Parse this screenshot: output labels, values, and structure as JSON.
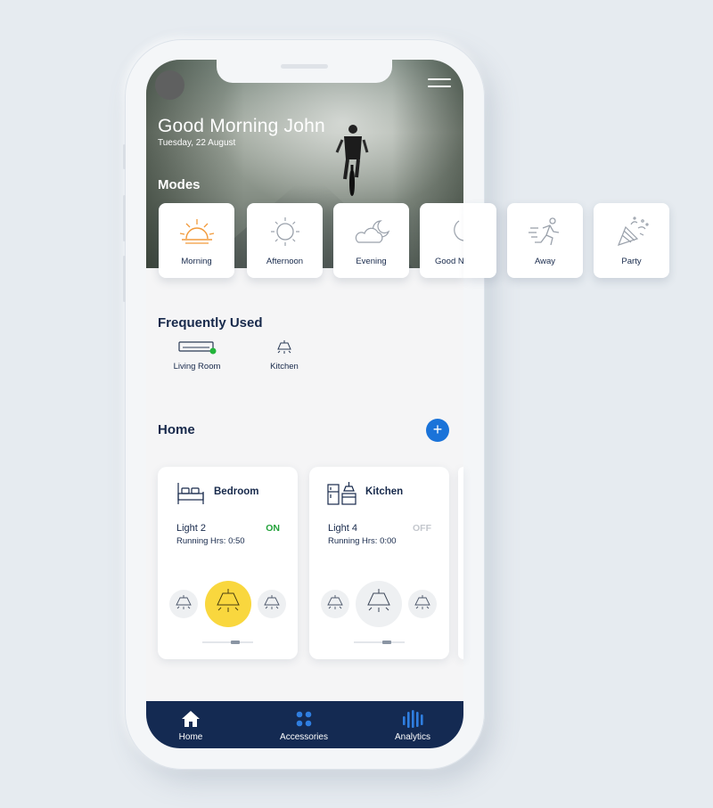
{
  "header": {
    "greeting": "Good Morning John",
    "date": "Tuesday, 22 August"
  },
  "modes": {
    "title": "Modes",
    "items": [
      {
        "label": "Morning",
        "icon": "sunrise-icon"
      },
      {
        "label": "Afternoon",
        "icon": "sun-icon"
      },
      {
        "label": "Evening",
        "icon": "cloud-moon-icon"
      },
      {
        "label": "Good N",
        "icon": "moon-icon"
      },
      {
        "label": "Away",
        "icon": "running-person-icon"
      },
      {
        "label": "Party",
        "icon": "party-popper-icon"
      }
    ]
  },
  "frequent": {
    "title": "Frequently Used",
    "items": [
      {
        "label": "Living Room",
        "icon": "air-conditioner-icon"
      },
      {
        "label": "Kitchen",
        "icon": "ceiling-lamp-icon"
      }
    ]
  },
  "home": {
    "title": "Home",
    "add_label": "+",
    "rooms": [
      {
        "name": "Bedroom",
        "icon": "bed-icon",
        "light": "Light 2",
        "status": "ON",
        "running": "Running Hrs: 0:50"
      },
      {
        "name": "Kitchen",
        "icon": "kitchen-icon",
        "light": "Light 4",
        "status": "OFF",
        "running": "Running Hrs: 0:00"
      }
    ]
  },
  "colors": {
    "accent": "#1a73d9",
    "on": "#22a23a",
    "off": "#c3c7cd",
    "lamp_active": "#f9d73e",
    "tabbar": "#142a52"
  },
  "tabs": [
    {
      "label": "Home",
      "icon": "home-icon"
    },
    {
      "label": "Accessories",
      "icon": "grid-dots-icon"
    },
    {
      "label": "Analytics",
      "icon": "bar-chart-icon"
    }
  ]
}
